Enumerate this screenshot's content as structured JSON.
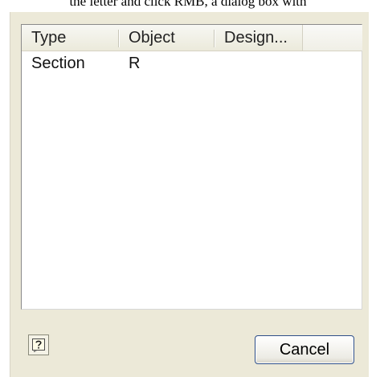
{
  "background_caption": "the letter and click RMB, a dialog box with",
  "list": {
    "columns": [
      "Type",
      "Object",
      "Design..."
    ],
    "rows": [
      {
        "type": "Section",
        "object": "R",
        "design": ""
      }
    ]
  },
  "buttons": {
    "help_icon": "help-icon",
    "cancel_label": "Cancel"
  },
  "colors": {
    "dialog_face": "#ece9d8",
    "button_border": "#2d4e88",
    "list_background": "#ffffff"
  }
}
